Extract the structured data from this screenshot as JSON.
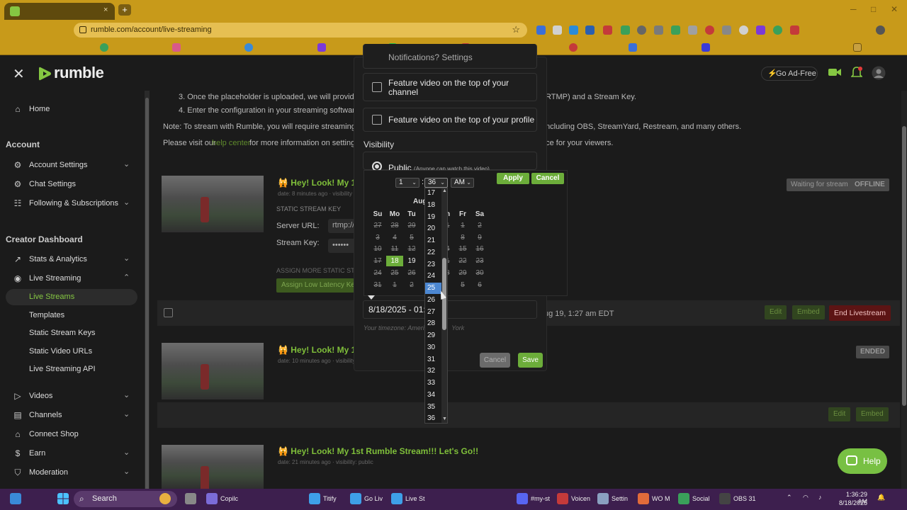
{
  "browser": {
    "url": "rumble.com/account/live-streaming",
    "tab_close": "×",
    "new_tab": "+",
    "win_min": "─",
    "win_max": "□",
    "win_close": "✕",
    "colors": {
      "frame": "#c89a1a",
      "omnibox": "#e6bf52"
    }
  },
  "header": {
    "logo": "rumble",
    "close": "✕",
    "go_ad_free": "Go Ad-Free"
  },
  "sidebar": {
    "home": "Home",
    "account_heading": "Account",
    "account_items": [
      {
        "label": "Account Settings",
        "icon": "gear-icon",
        "chevron": "⌄"
      },
      {
        "label": "Chat Settings",
        "icon": "chat-gear-icon"
      },
      {
        "label": "Following & Subscriptions",
        "icon": "following-icon",
        "chevron": "⌄"
      }
    ],
    "creator_heading": "Creator Dashboard",
    "creator_items": [
      {
        "label": "Stats & Analytics",
        "icon": "trend-icon",
        "chevron": "⌄"
      },
      {
        "label": "Live Streaming",
        "icon": "broadcast-icon",
        "chevron": "⌃"
      }
    ],
    "live_sub": [
      "Live Streams",
      "Templates",
      "Static Stream Keys",
      "Static Video URLs",
      "Live Streaming API"
    ],
    "more_items": [
      {
        "label": "Videos",
        "icon": "play-icon",
        "chevron": "⌄"
      },
      {
        "label": "Channels",
        "icon": "channels-icon",
        "chevron": "⌄"
      },
      {
        "label": "Connect Shop",
        "icon": "shop-icon"
      },
      {
        "label": "Earn",
        "icon": "dollar-icon",
        "chevron": "⌄"
      },
      {
        "label": "Moderation",
        "icon": "shield-icon",
        "chevron": "⌄"
      }
    ]
  },
  "main": {
    "step3": "3. Once the placeholder is uploaded, we will provide you",
    "step3_tail": "RTMP) and a Stream Key.",
    "step4": "4. Enter the configuration in your streaming software.",
    "note": "Note: To stream with Rumble, you will require streaming softv",
    "note_tail": "ncluding OBS, StreamYard, Restream, and many others.",
    "visit": "Please visit our",
    "help_center": "help center",
    "visit_mid": "for more information on setting up",
    "visit_tail": "nce for your viewers.",
    "stream1": {
      "title": "Hey! Look! My 1st",
      "meta": "date: 8 minutes ago · visibility",
      "static_key_label": "STATIC STREAM KEY",
      "server_url_label": "Server URL:",
      "server_url_value": "rtmp://",
      "stream_key_label": "Stream Key:",
      "stream_key_value": "••••••",
      "assign_more": "ASSIGN MORE STATIC STR",
      "assign_low": "Assign Low Latency Ke",
      "waiting": "Waiting for stream",
      "offline": "OFFLINE"
    },
    "row1": {
      "starts": "ug 19, 1:27 am EDT",
      "edit": "Edit",
      "embed": "Embed",
      "end": "End Livestream"
    },
    "stream2": {
      "title": "Hey! Look! My 1s",
      "meta": "date: 10 minutes ago · visibility",
      "status": "ENDED"
    },
    "row2": {
      "edit": "Edit",
      "embed": "Embed"
    },
    "stream3": {
      "title": "Hey! Look! My 1st Rumble Stream!!! Let's Go!!",
      "meta": "date: 21 minutes ago · visibility: public"
    }
  },
  "modal": {
    "truncated_top": "Notifications? Settings",
    "feature_channel": "Feature video on the top of your channel",
    "feature_profile": "Feature video on the top of your profile",
    "visibility": "Visibility",
    "public": "Public",
    "public_note": "(Anyone can watch this video)",
    "datetime": "8/18/2025 - 01:3",
    "timezone": "Your timezone: America/New_York",
    "timezone_a": "Your timezone:",
    "timezone_b": "Americ",
    "timezone_c": "York",
    "cancel": "Cancel",
    "save": "Save"
  },
  "picker": {
    "hour": "1",
    "minute": "36",
    "ampm": "AM",
    "apply": "Apply",
    "cancel": "Cancel",
    "month": "Aug",
    "dow": [
      "Su",
      "Mo",
      "Tu",
      "W",
      "Th",
      "Fr",
      "Sa"
    ],
    "weeks": [
      [
        "27",
        "28",
        "29",
        "30",
        "31",
        "1",
        "2"
      ],
      [
        "3",
        "4",
        "5",
        "6",
        "7",
        "8",
        "9"
      ],
      [
        "10",
        "11",
        "12",
        "13",
        "14",
        "15",
        "16"
      ],
      [
        "17",
        "18",
        "19",
        "20",
        "21",
        "22",
        "23"
      ],
      [
        "24",
        "25",
        "26",
        "27",
        "28",
        "29",
        "30"
      ],
      [
        "31",
        "1",
        "2",
        "3",
        "4",
        "5",
        "6"
      ]
    ],
    "today": "18",
    "available": [
      "19"
    ],
    "minute_options": [
      "17",
      "18",
      "19",
      "20",
      "21",
      "22",
      "23",
      "24",
      "25",
      "26",
      "27",
      "28",
      "29",
      "30",
      "31",
      "32",
      "33",
      "34",
      "35",
      "36"
    ],
    "highlighted_minute": "25"
  },
  "help": "Help",
  "taskbar": {
    "search": "Search",
    "apps": [
      {
        "label": "Copilc",
        "color": "#7b6cd8"
      },
      {
        "label": "Titify",
        "color": "#3ea0e8"
      },
      {
        "label": "Go Liv",
        "color": "#3ea0e8"
      },
      {
        "label": "Live St",
        "color": "#3ea0e8"
      },
      {
        "label": "#my-st",
        "color": "#5865f2"
      },
      {
        "label": "Voicen",
        "color": "#c43a3a"
      },
      {
        "label": "Settin",
        "color": "#8aa0c0"
      },
      {
        "label": "WO M",
        "color": "#e26b3a"
      },
      {
        "label": "Social",
        "color": "#3aa05a"
      },
      {
        "label": "OBS 31",
        "color": "#444444"
      }
    ],
    "time": "1:36:29 AM",
    "date": "8/18/2025"
  }
}
